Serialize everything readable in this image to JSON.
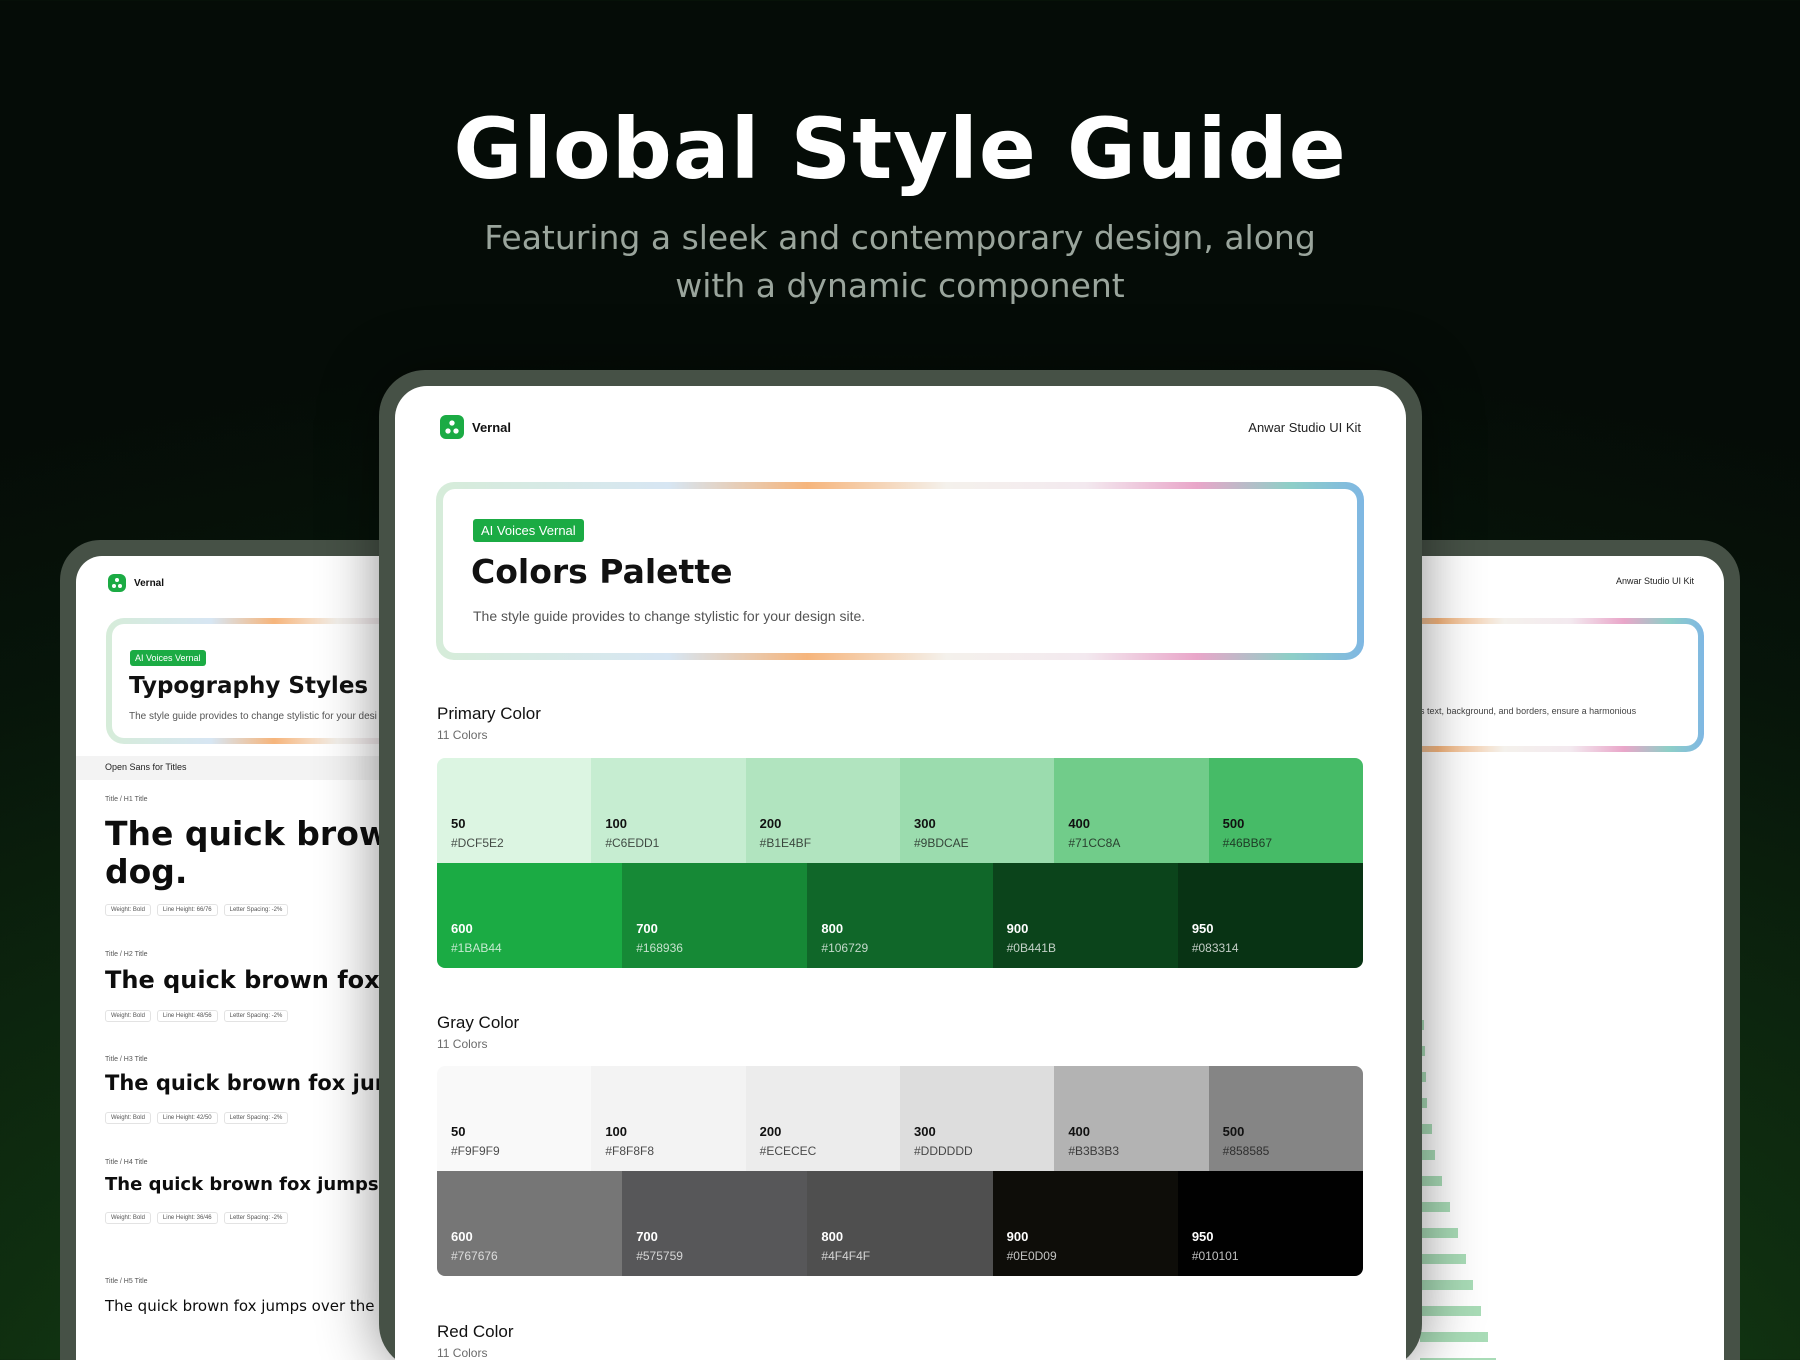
{
  "hero": {
    "title": "Global Style Guide",
    "subtitle": "Featuring a sleek and contemporary design, along with a dynamic component"
  },
  "brand": {
    "name": "Vernal",
    "kit_label": "Anwar Studio UI Kit"
  },
  "center_page": {
    "badge": "AI Voices Vernal",
    "title": "Colors Palette",
    "description": "The style guide provides to change stylistic for your design site.",
    "sections": [
      {
        "title": "Primary Color",
        "count": "11 Colors",
        "row1": [
          {
            "num": "50",
            "hex": "#DCF5E2",
            "color": "#dcf5e2",
            "text": "#111"
          },
          {
            "num": "100",
            "hex": "#C6EDD1",
            "color": "#c6edd1",
            "text": "#111"
          },
          {
            "num": "200",
            "hex": "#B1E4BF",
            "color": "#b1e4bf",
            "text": "#111"
          },
          {
            "num": "300",
            "hex": "#9BDCAE",
            "color": "#9bdcae",
            "text": "#111"
          },
          {
            "num": "400",
            "hex": "#71CC8A",
            "color": "#71cc8a",
            "text": "#111"
          },
          {
            "num": "500",
            "hex": "#46BB67",
            "color": "#46bb67",
            "text": "#111"
          }
        ],
        "row2": [
          {
            "num": "600",
            "hex": "#1BAB44",
            "color": "#1bab44",
            "text": "#fff"
          },
          {
            "num": "700",
            "hex": "#168936",
            "color": "#168936",
            "text": "#fff"
          },
          {
            "num": "800",
            "hex": "#106729",
            "color": "#106729",
            "text": "#fff"
          },
          {
            "num": "900",
            "hex": "#0B441B",
            "color": "#0b441b",
            "text": "#fff"
          },
          {
            "num": "950",
            "hex": "#083314",
            "color": "#083314",
            "text": "#fff"
          }
        ]
      },
      {
        "title": "Gray Color",
        "count": "11 Colors",
        "row1": [
          {
            "num": "50",
            "hex": "#F9F9F9",
            "color": "#f9f9f9",
            "text": "#111"
          },
          {
            "num": "100",
            "hex": "#F8F8F8",
            "color": "#f3f3f3",
            "text": "#111"
          },
          {
            "num": "200",
            "hex": "#ECECEC",
            "color": "#ececec",
            "text": "#111"
          },
          {
            "num": "300",
            "hex": "#DDDDDD",
            "color": "#dddddd",
            "text": "#111"
          },
          {
            "num": "400",
            "hex": "#B3B3B3",
            "color": "#b3b3b3",
            "text": "#111"
          },
          {
            "num": "500",
            "hex": "#858585",
            "color": "#858585",
            "text": "#111"
          }
        ],
        "row2": [
          {
            "num": "600",
            "hex": "#767676",
            "color": "#767676",
            "text": "#fff"
          },
          {
            "num": "700",
            "hex": "#575759",
            "color": "#575759",
            "text": "#fff"
          },
          {
            "num": "800",
            "hex": "#4F4F4F",
            "color": "#4f4f4f",
            "text": "#fff"
          },
          {
            "num": "900",
            "hex": "#0E0D09",
            "color": "#0e0d09",
            "text": "#fff"
          },
          {
            "num": "950",
            "hex": "#010101",
            "color": "#010101",
            "text": "#fff"
          }
        ]
      },
      {
        "title": "Red Color",
        "count": "11 Colors"
      }
    ]
  },
  "left_page": {
    "badge": "AI Voices Vernal",
    "title": "Typography Styles",
    "description": "The style guide provides to change stylistic for your desi",
    "font_label": "Open Sans for Titles",
    "styles": [
      {
        "meta": "Title / H1 Title",
        "sample_line1": "The quick brown f",
        "sample_line2": "dog.",
        "weight": "Weight: Bold",
        "line_height": "Line Height: 66/76",
        "spacing": "Letter Spacing: -2%"
      },
      {
        "meta": "Title / H2 Title",
        "sample_line1": "The quick brown fox jum",
        "weight": "Weight: Bold",
        "line_height": "Line Height: 48/56",
        "spacing": "Letter Spacing: -2%"
      },
      {
        "meta": "Title / H3 Title",
        "sample_line1": "The quick brown fox jumps",
        "weight": "Weight: Bold",
        "line_height": "Line Height: 42/50",
        "spacing": "Letter Spacing: -2%"
      },
      {
        "meta": "Title / H4 Title",
        "sample_line1": "The quick brown fox jumps over",
        "weight": "Weight: Bold",
        "line_height": "Line Height: 36/46",
        "spacing": "Letter Spacing: -2%"
      },
      {
        "meta": "Title / H5 Title",
        "sample_line1": "The quick brown fox jumps over the l"
      }
    ]
  },
  "right_page": {
    "description": "s text, background, and borders, ensure a harmonious"
  }
}
